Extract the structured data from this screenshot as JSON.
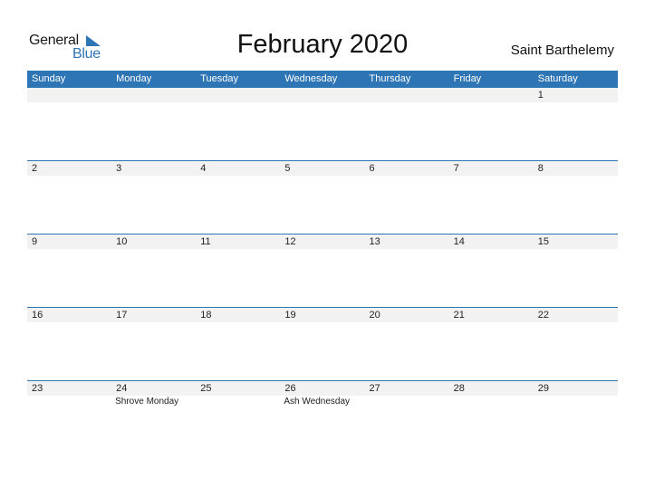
{
  "logo": {
    "general": "General",
    "blue": "Blue"
  },
  "title": "February 2020",
  "country": "Saint Barthelemy",
  "colors": {
    "accent": "#2e75b6",
    "row_bg": "#f2f2f2"
  },
  "weekdays": [
    "Sunday",
    "Monday",
    "Tuesday",
    "Wednesday",
    "Thursday",
    "Friday",
    "Saturday"
  ],
  "weeks": [
    {
      "days": [
        "",
        "",
        "",
        "",
        "",
        "",
        "1"
      ],
      "events": [
        "",
        "",
        "",
        "",
        "",
        "",
        ""
      ]
    },
    {
      "days": [
        "2",
        "3",
        "4",
        "5",
        "6",
        "7",
        "8"
      ],
      "events": [
        "",
        "",
        "",
        "",
        "",
        "",
        ""
      ]
    },
    {
      "days": [
        "9",
        "10",
        "11",
        "12",
        "13",
        "14",
        "15"
      ],
      "events": [
        "",
        "",
        "",
        "",
        "",
        "",
        ""
      ]
    },
    {
      "days": [
        "16",
        "17",
        "18",
        "19",
        "20",
        "21",
        "22"
      ],
      "events": [
        "",
        "",
        "",
        "",
        "",
        "",
        ""
      ]
    },
    {
      "days": [
        "23",
        "24",
        "25",
        "26",
        "27",
        "28",
        "29"
      ],
      "events": [
        "",
        "Shrove Monday",
        "",
        "Ash Wednesday",
        "",
        "",
        ""
      ]
    }
  ]
}
